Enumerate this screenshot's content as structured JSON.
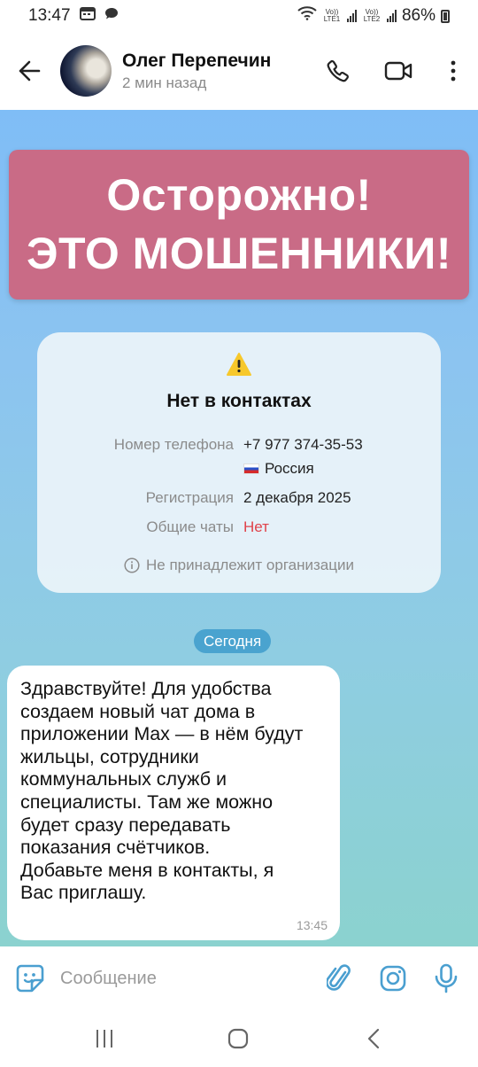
{
  "status_bar": {
    "time": "13:47",
    "battery_percent": "86%",
    "sim1_label": "Vo)) LTE1",
    "sim2_label": "Vo)) LTE2"
  },
  "header": {
    "contact_name": "Олег Перепечин",
    "last_seen": "2 мин назад",
    "icons": [
      "back-arrow-icon",
      "phone-icon",
      "video-icon",
      "more-vertical-icon"
    ]
  },
  "warning_banner": {
    "line1": "Осторожно!",
    "line2": "ЭТО МОШЕННИКИ!"
  },
  "contact_card": {
    "title": "Нет в контактах",
    "rows": [
      {
        "label": "Номер телефона",
        "value": "+7 977 374-35-53"
      },
      {
        "label": "",
        "value": "Россия"
      },
      {
        "label": "Регистрация",
        "value": "2 декабря 2025"
      },
      {
        "label": "Общие чаты",
        "value": "Нет"
      }
    ],
    "org_note": "Не принадлежит организации"
  },
  "date_separator": "Сегодня",
  "message": {
    "text": "Здравствуйте! Для удобства\nсоздаем новый чат дома в\nприложении Max — в нём будут\nжильцы, сотрудники\nкоммунальных служб и\nспециалисты. Там же можно\nбудет сразу передавать\nпоказания счётчиков.\nДобавьте меня в контакты, я\nВас приглашу.",
    "time": "13:45"
  },
  "input_bar": {
    "placeholder": "Сообщение"
  },
  "colors": {
    "banner": "#c96b86",
    "accent": "#4aa3cf",
    "alert": "#e0424a"
  }
}
